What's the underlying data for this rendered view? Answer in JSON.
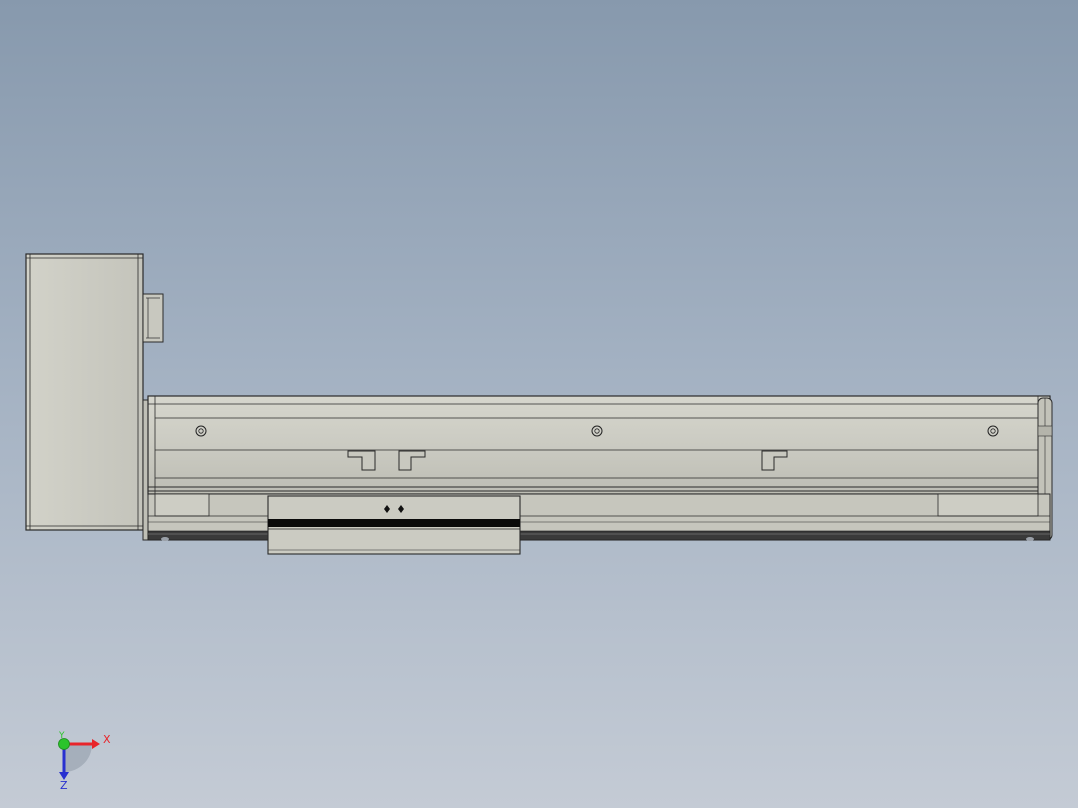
{
  "viewport": {
    "background_top": "#8799ad",
    "background_bottom": "#c4cbd5"
  },
  "model": {
    "part_color": "#cbcbc2",
    "part_shadow": "#b7b7ad",
    "edge_color": "#2a2a2a",
    "belt_color": "#0a0a0a"
  },
  "triad": {
    "x_label": "X",
    "y_label": "Y",
    "z_label": "Z",
    "x_color": "#e8242a",
    "y_color": "#2bc42b",
    "z_color": "#2830d0"
  }
}
